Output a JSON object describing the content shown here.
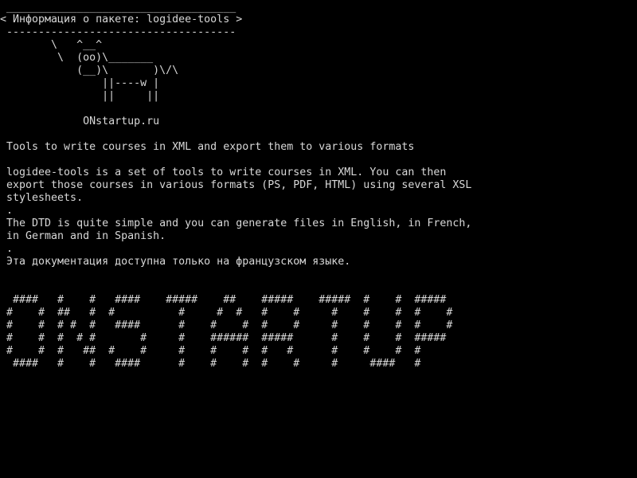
{
  "colors": {
    "background": "#000000",
    "text": "#d8d8d8"
  },
  "speech_bubble": {
    "top_border": " ____________________________________",
    "title": "< Информация о пакете: logidee-tools >",
    "bottom_border": " ------------------------------------"
  },
  "cow_art": [
    "        \\   ^__^",
    "         \\  (oo)\\_______",
    "            (__)\\       )\\/\\",
    "                ||----w |",
    "                ||     ||"
  ],
  "site": "             ONstartup.ru",
  "summary": " Tools to write courses in XML and export them to various formats",
  "description": [
    " logidee-tools is a set of tools to write courses in XML. You can then",
    " export those courses in various formats (PS, PDF, HTML) using several XSL",
    " stylesheets.",
    " .",
    " The DTD is quite simple and you can generate files in English, in French,",
    " in German and in Spanish.",
    " .",
    " Эта документация доступна только на французском языке."
  ],
  "banner": [
    "  ####   #    #   ####    #####    ##    #####    #####  #    #  #####",
    " #    #  ##   #  #          #     #  #   #    #     #    #    #  #    #",
    " #    #  # #  #   ####      #    #    #  #    #     #    #    #  #    #",
    " #    #  #  # #       #     #    ######  #####      #    #    #  #####",
    " #    #  #   ##  #    #     #    #    #  #   #      #    #    #  #",
    "  ####   #    #   ####      #    #    #  #    #     #     ####   #"
  ]
}
